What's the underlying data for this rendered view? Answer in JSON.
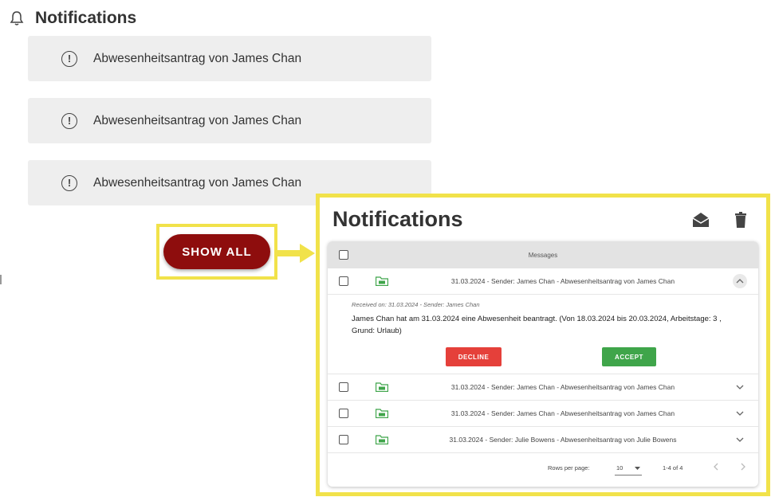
{
  "header": {
    "title": "Notifications",
    "icon": "bell-icon"
  },
  "notifications": [
    {
      "text": "Abwesenheitsantrag von James Chan",
      "icon": "alert-circle-icon"
    },
    {
      "text": "Abwesenheitsantrag von James Chan",
      "icon": "alert-circle-icon"
    },
    {
      "text": "Abwesenheitsantrag von James Chan",
      "icon": "alert-circle-icon"
    }
  ],
  "show_all": {
    "label": "SHOW ALL",
    "color": "#8e0d0d"
  },
  "highlight_color": "#f1e24a",
  "dialog": {
    "title": "Notifications",
    "actions": [
      "mark-read-envelope-icon",
      "trash-icon"
    ],
    "table": {
      "header": "Messages",
      "rows": [
        {
          "text": "31.03.2024 - Sender: James Chan - Abwesenheitsantrag von James Chan",
          "expanded": true
        },
        {
          "text": "31.03.2024 - Sender: James Chan - Abwesenheitsantrag von James Chan",
          "expanded": false
        },
        {
          "text": "31.03.2024 - Sender: James Chan - Abwesenheitsantrag von James Chan",
          "expanded": false
        },
        {
          "text": "31.03.2024 - Sender: Julie Bowens - Abwesenheitsantrag von Julie Bowens",
          "expanded": false
        }
      ],
      "detail": {
        "received": "Received on: 31.03.2024 - Sender: James Chan",
        "body": "James Chan hat am 31.03.2024 eine Abwesenheit beantragt. (Von 18.03.2024 bis 20.03.2024, Arbeitstage: 3 , Grund: Urlaub)",
        "decline": "DECLINE",
        "accept": "ACCEPT"
      },
      "pagination": {
        "rows_per_page_label": "Rows per page:",
        "rows_per_page": "10",
        "range": "1-4 of 4"
      }
    }
  },
  "colors": {
    "decline": "#e5403a",
    "accept": "#3fa54a",
    "folder": "#3fa54a"
  }
}
